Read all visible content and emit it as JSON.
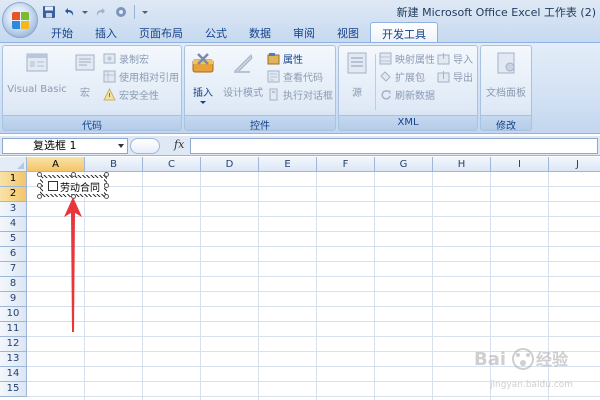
{
  "window": {
    "title": "新建 Microsoft Office Excel 工作表 (2)"
  },
  "tabs": [
    {
      "label": "开始",
      "active": false
    },
    {
      "label": "插入",
      "active": false
    },
    {
      "label": "页面布局",
      "active": false
    },
    {
      "label": "公式",
      "active": false
    },
    {
      "label": "数据",
      "active": false
    },
    {
      "label": "审阅",
      "active": false
    },
    {
      "label": "视图",
      "active": false
    },
    {
      "label": "开发工具",
      "active": true
    }
  ],
  "ribbon": {
    "code": {
      "label": "代码",
      "visual_basic": "Visual Basic",
      "macro": "宏",
      "record_macro": "录制宏",
      "relative_ref": "使用相对引用",
      "macro_security": "宏安全性"
    },
    "controls": {
      "label": "控件",
      "insert": "插入",
      "design_mode": "设计模式",
      "properties": "属性",
      "view_code": "查看代码",
      "run_dialog": "执行对话框"
    },
    "xml": {
      "label": "XML",
      "source": "源",
      "map_properties": "映射属性",
      "expansion_pack": "扩展包",
      "refresh_data": "刷新数据",
      "import": "导入",
      "export": "导出"
    },
    "modify": {
      "label": "修改",
      "document_panel": "文档面板"
    }
  },
  "formula_bar": {
    "name_box": "复选框 1",
    "fx": "fx",
    "formula": ""
  },
  "sheet": {
    "columns": [
      "A",
      "B",
      "C",
      "D",
      "E",
      "F",
      "G",
      "H",
      "I",
      "J"
    ],
    "rows": [
      "1",
      "2",
      "3",
      "4",
      "5",
      "6",
      "7",
      "8",
      "9",
      "10",
      "11",
      "12",
      "13",
      "14",
      "15"
    ],
    "selected_column": "A",
    "selected_rows": [
      "1",
      "2"
    ]
  },
  "checkbox_control": {
    "label": "劳动合同",
    "checked": false
  },
  "colors": {
    "arrow": "#e8363a",
    "accent": "#15428b"
  },
  "watermark": {
    "brand": "Baidu",
    "text": "经验",
    "url": "jingyan.baidu.com"
  }
}
